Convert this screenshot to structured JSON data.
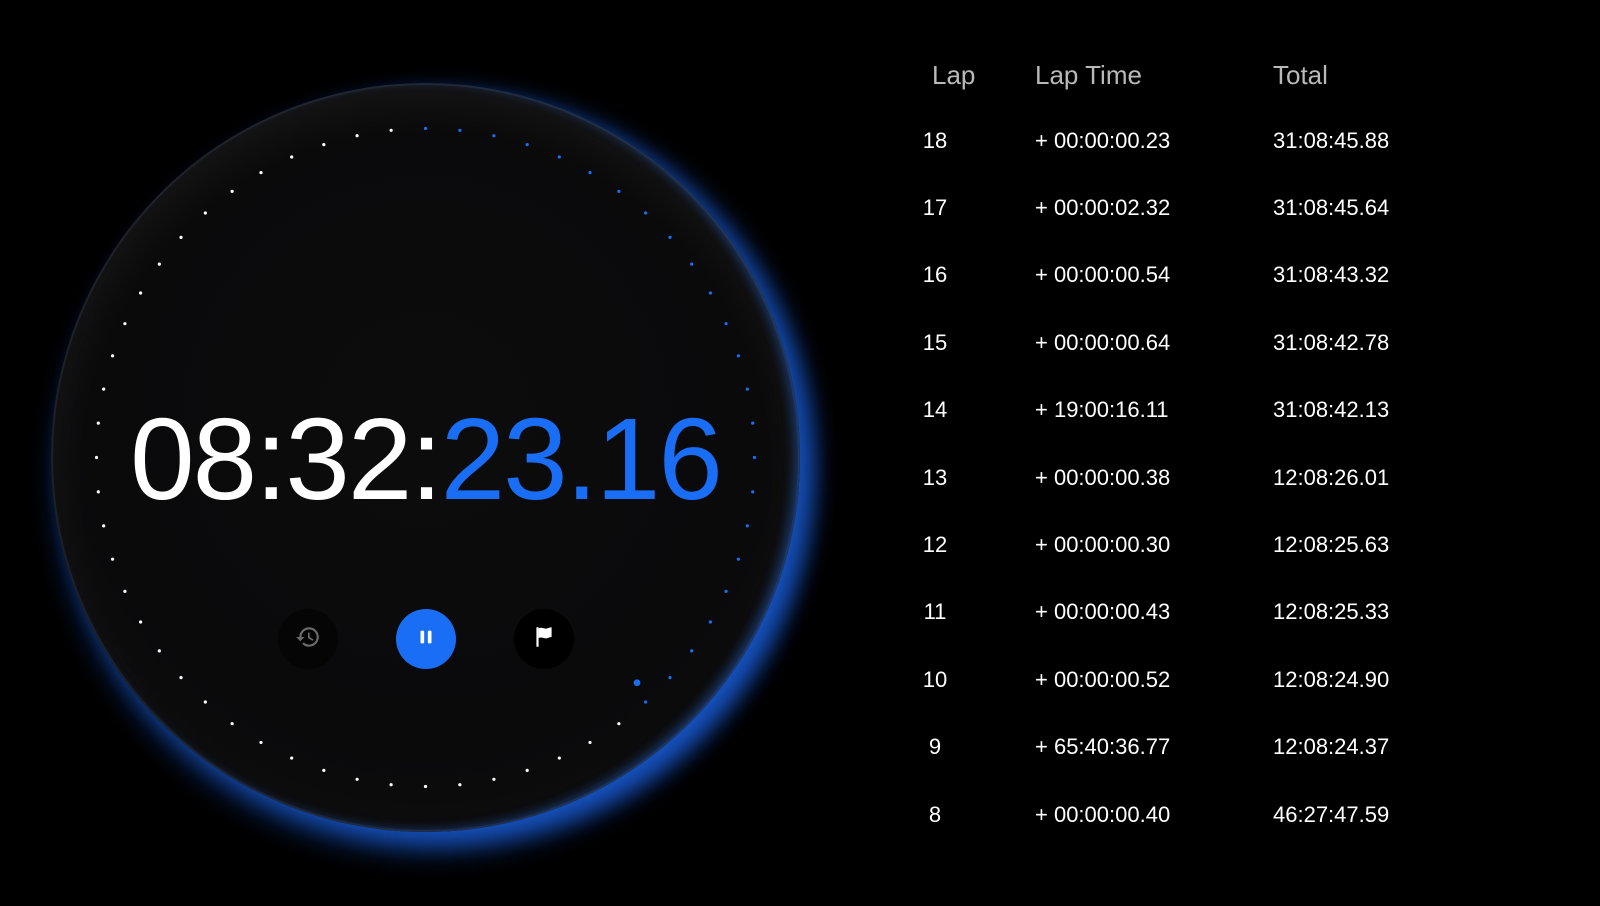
{
  "stopwatch": {
    "time_main": "08:32:",
    "time_accent": "23.16",
    "progress_fraction": 0.38,
    "colors": {
      "accent": "#1a6ef5",
      "tick_inactive": "#ffffff",
      "background": "#000000"
    },
    "controls": {
      "history_icon": "history-icon",
      "pause_icon": "pause-icon",
      "lap_icon": "flag-icon"
    }
  },
  "laps": {
    "headers": {
      "lap": "Lap",
      "lap_time": "Lap Time",
      "total": "Total"
    },
    "rows": [
      {
        "lap": "18",
        "lap_time": "+ 00:00:00.23",
        "total": "31:08:45.88"
      },
      {
        "lap": "17",
        "lap_time": "+ 00:00:02.32",
        "total": "31:08:45.64"
      },
      {
        "lap": "16",
        "lap_time": "+ 00:00:00.54",
        "total": "31:08:43.32"
      },
      {
        "lap": "15",
        "lap_time": "+ 00:00:00.64",
        "total": "31:08:42.78"
      },
      {
        "lap": "14",
        "lap_time": "+ 19:00:16.11",
        "total": "31:08:42.13"
      },
      {
        "lap": "13",
        "lap_time": "+ 00:00:00.38",
        "total": "12:08:26.01"
      },
      {
        "lap": "12",
        "lap_time": "+ 00:00:00.30",
        "total": "12:08:25.63"
      },
      {
        "lap": "11",
        "lap_time": "+ 00:00:00.43",
        "total": "12:08:25.33"
      },
      {
        "lap": "10",
        "lap_time": "+ 00:00:00.52",
        "total": "12:08:24.90"
      },
      {
        "lap": "9",
        "lap_time": "+ 65:40:36.77",
        "total": "12:08:24.37"
      },
      {
        "lap": "8",
        "lap_time": "+ 00:00:00.40",
        "total": "46:27:47.59"
      }
    ]
  }
}
